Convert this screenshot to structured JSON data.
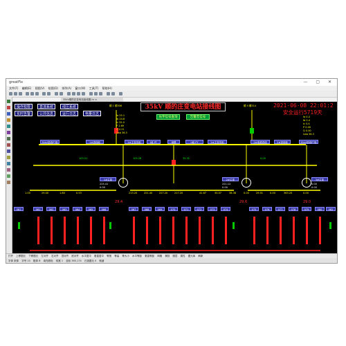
{
  "window": {
    "title": "greatFix",
    "minimize": "—",
    "maximize": "▢",
    "close": "✕"
  },
  "menu": [
    "文件(F)",
    "编辑(E)",
    "视图(V)",
    "绘图(D)",
    "排列(A)",
    "窗口(W)",
    "工具(T)",
    "帮助(H)"
  ],
  "doc_tab": "35kV顺的庄变电站接线图.hr ×",
  "nav": {
    "row1": [
      "操作权限",
      "直流系统",
      "线压系统"
    ],
    "row2": [
      "实时告警",
      "公共信息",
      "运行日志",
      "电量日志"
    ]
  },
  "title": "35kV 顺的庄变电站接线图",
  "buttons": {
    "left": "光字信号查询",
    "right": "告警音信号"
  },
  "datetime": "2021-06-08 22:01:2",
  "safe_run": "安全运行5719天",
  "lines": {
    "left": "顺 1 顺306",
    "right": "顺 II 顺314"
  },
  "bus_labels": [
    "35kV进线PT柜",
    "1#进线柜",
    "1#主变压柜",
    "I段 PT",
    "母联",
    "II段 PT",
    "2#主变压柜",
    "2#电源进线",
    "2#进线柜",
    "35kV进线PT柜"
  ],
  "left_meas": [
    "Ia 25.1",
    "Ib 24.8",
    "Ic 25.0",
    "P 1.69",
    "Q 0.21",
    "Uab 36.3"
  ],
  "right_meas": [
    "Ia 0.4",
    "Ib 0.4",
    "Ic 0.4",
    "P 0.00",
    "Q 0.00",
    "Uab 36.3"
  ],
  "mid_values": [
    "103.51",
    "105.28",
    "35.32",
    "0.00"
  ],
  "transformers": [
    {
      "label": "1#主变",
      "vals": [
        "225.41",
        "0.00"
      ]
    },
    {
      "label": "2#主变",
      "vals": [
        "221.12",
        "0.00"
      ]
    },
    {
      "label": "3#主变",
      "vals": [
        "0.00",
        "0.00"
      ]
    }
  ],
  "lv_values": [
    "1.00",
    "29.00",
    "1.80",
    "0.53",
    "213.20",
    "221.40",
    "227.20",
    "217.20",
    "41.67",
    "30.07",
    "38.38",
    "0.00",
    "29.51",
    "0.00",
    "363.20",
    "0.00"
  ],
  "temps": [
    "29.4",
    "29.6",
    "29.0"
  ],
  "feeders": [
    "061",
    "062",
    "063",
    "064",
    "065",
    "066",
    "067",
    "068",
    "069",
    "070",
    "071",
    "072",
    "073",
    "074",
    "075",
    "076",
    "077",
    "078",
    "079",
    "080",
    "081",
    "082"
  ],
  "statusbar": [
    "打开",
    "上移图元",
    "下移图元",
    "左对齐",
    "右对齐",
    "顶对齐",
    "底对齐",
    "水平居中",
    "垂直居中",
    "等宽",
    "等高",
    "等大小",
    "水平等距",
    "垂直等距",
    "网格",
    "捕捉",
    "图层",
    "属性",
    "图元库",
    "刷新"
  ],
  "bottombar": [
    "字体 宋体",
    "字号 10",
    "粗体 B",
    "填充颜色",
    "线宽 1",
    "坐标 385,174",
    "已选图元 0",
    "就绪"
  ],
  "colors": {
    "canvas": "#000000",
    "title": "#ff2a2a",
    "bus": "#ffff00",
    "nav": "#0a0a6e"
  }
}
